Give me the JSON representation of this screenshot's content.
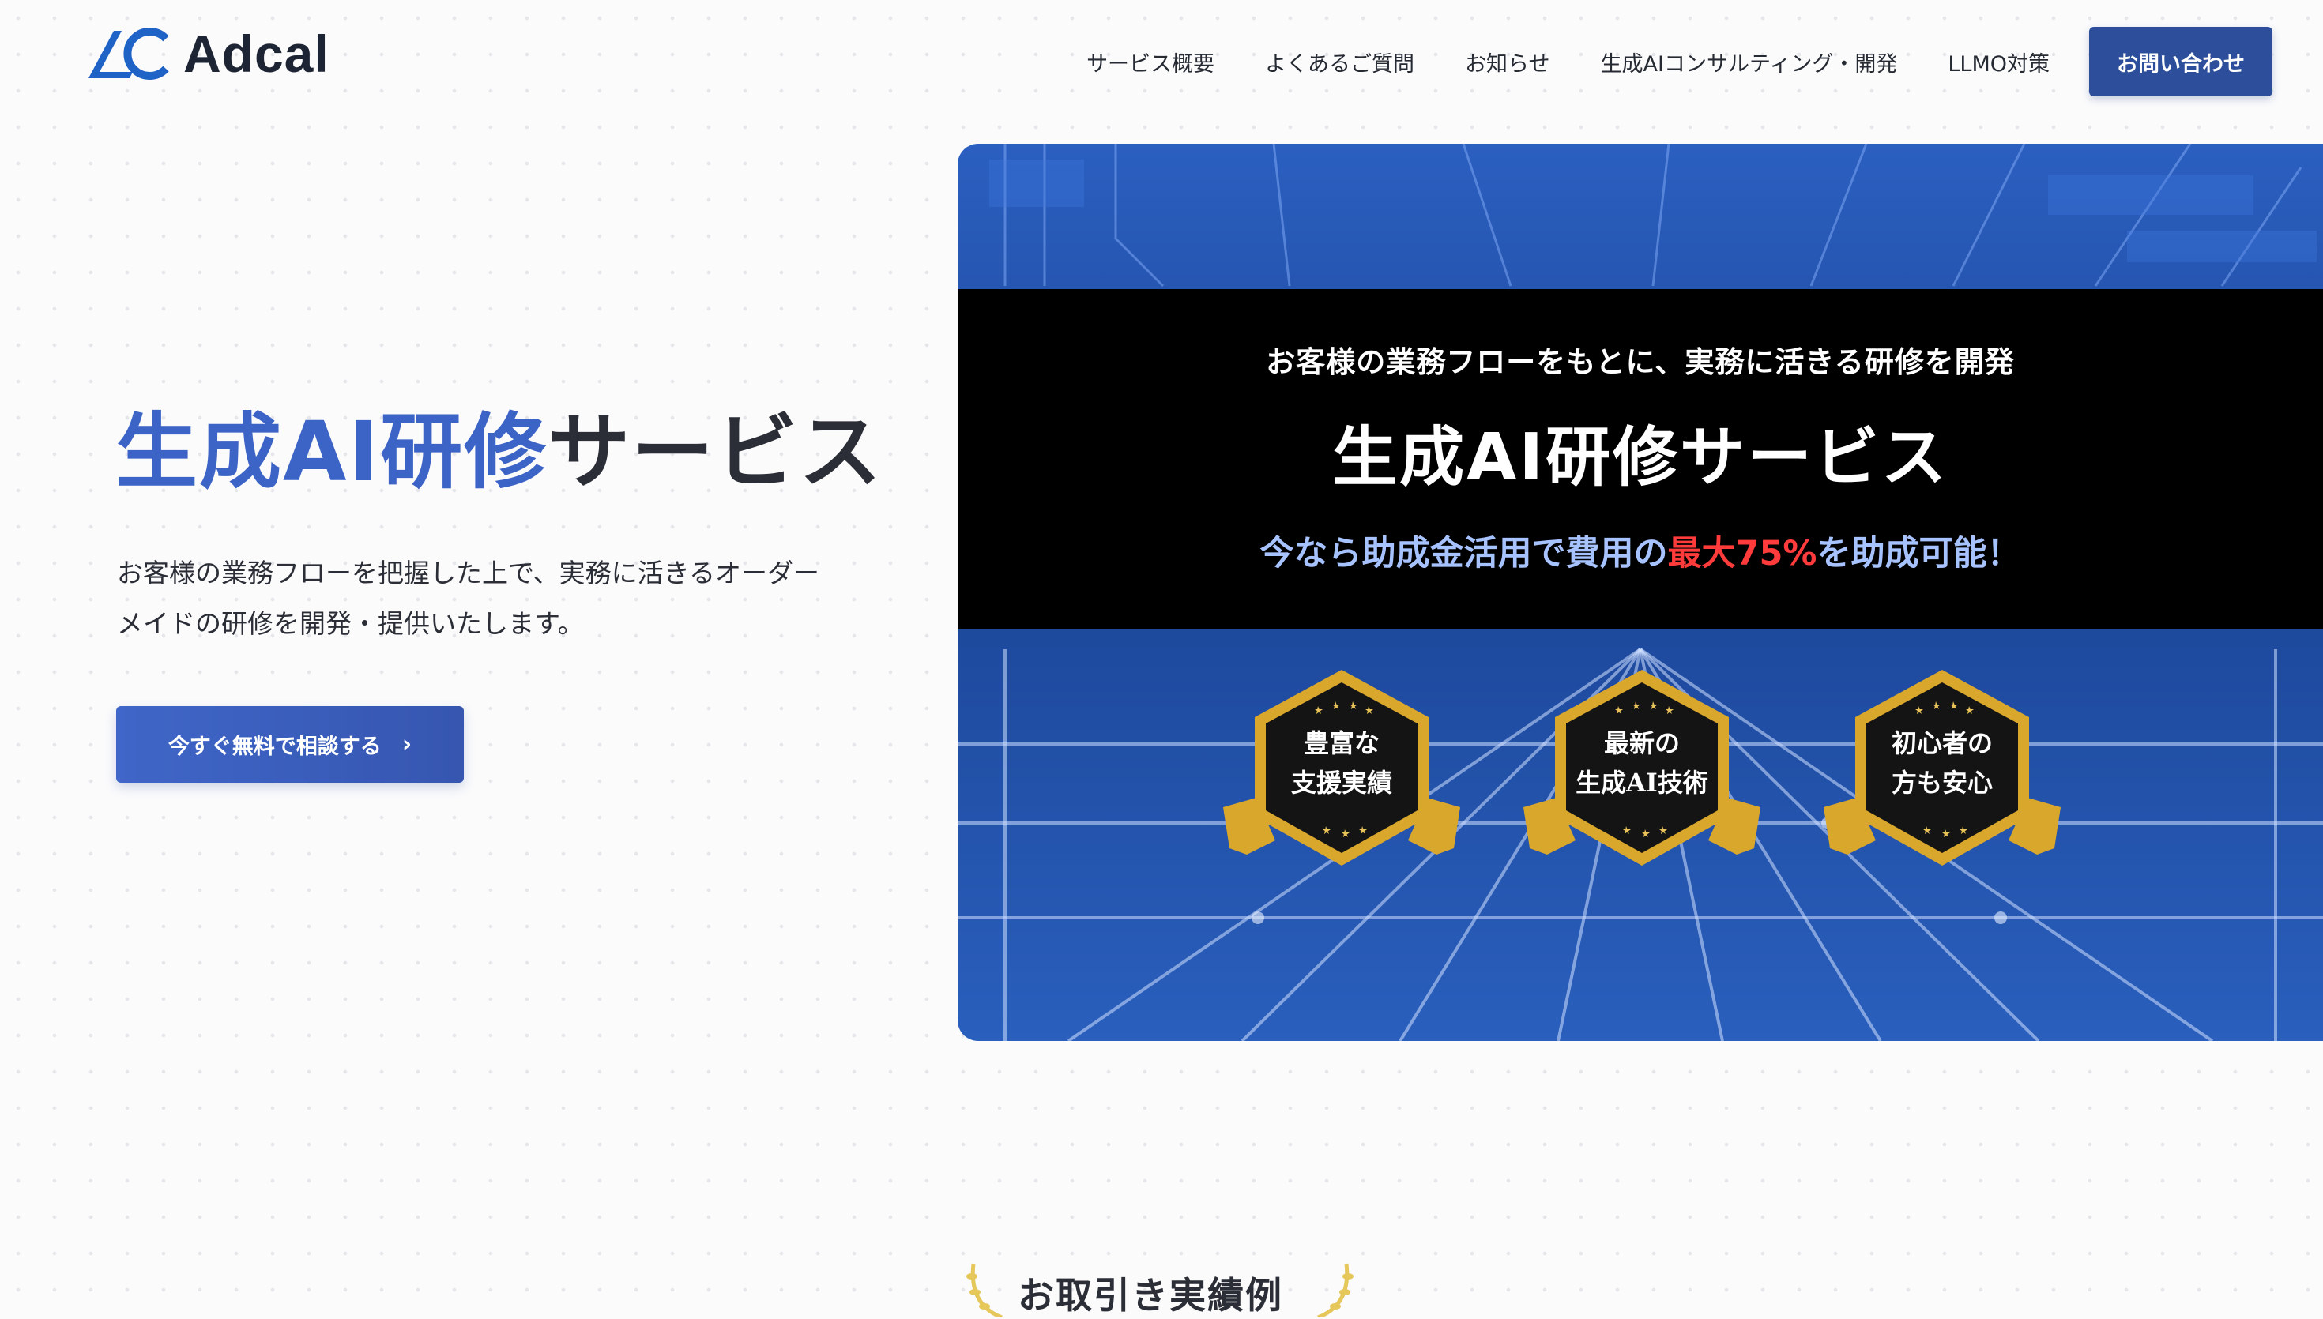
{
  "brand": {
    "name": "Adcal"
  },
  "nav": {
    "items": [
      "サービス概要",
      "よくあるご質問",
      "お知らせ",
      "生成AIコンサルティング・開発",
      "LLMO対策"
    ],
    "contact_label": "お問い合わせ"
  },
  "hero": {
    "title_accent": "生成AI研修",
    "title_rest": "サービス",
    "description_lines": [
      "お客様の業務フローを把握した上で、実務に活きるオーダー",
      "メイドの研修を開発・提供いたします。"
    ],
    "cta_label": "今すぐ無料で相談する",
    "cta_icon": "chevron-right-icon"
  },
  "banner": {
    "subtitle": "お客様の業務フローをもとに、実務に活きる研修を開発",
    "title": "生成AI研修サービス",
    "offer_prefix": "今なら助成金活用で費用の",
    "offer_highlight": "最大75%",
    "offer_suffix": "を助成可能！",
    "badges": [
      {
        "line1": "豊富な",
        "line2": "支援実績"
      },
      {
        "line1": "最新の",
        "line2": "生成AI技術"
      },
      {
        "line1": "初心者の",
        "line2": "方も安心"
      }
    ]
  },
  "section": {
    "achievements_title": "お取引き実績例"
  },
  "colors": {
    "accent": "#3c63c6",
    "contact_button": "#2d4f9b",
    "highlight_red": "#ff3b3b",
    "badge_gold": "#d9a72c"
  }
}
